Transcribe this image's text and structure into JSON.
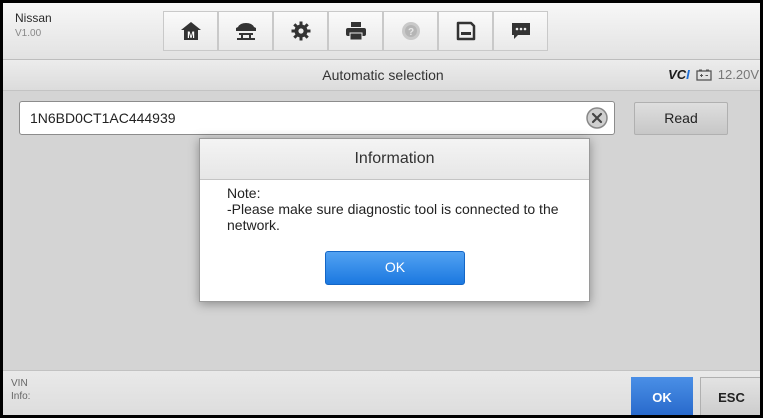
{
  "app": {
    "brand": "Nissan",
    "version": "V1.00"
  },
  "toolbar": {
    "icons": [
      "home-icon",
      "vehicle-lift-icon",
      "gear-icon",
      "printer-icon",
      "help-icon",
      "save-icon",
      "message-icon"
    ],
    "help_disabled": true
  },
  "header": {
    "title": "Automatic selection",
    "connection_label": "VCI",
    "voltage": "12.20V"
  },
  "vin_row": {
    "value": "1N6BD0CT1AC444939",
    "read_label": "Read"
  },
  "dialog": {
    "title": "Information",
    "lines": [
      "Note:",
      "-Please make sure diagnostic tool is connected to the network."
    ],
    "ok_label": "OK"
  },
  "bottom": {
    "info_line1": "VIN",
    "info_line2": "Info:",
    "ok_label": "OK",
    "esc_label": "ESC"
  },
  "colors": {
    "accent": "#1b78e0",
    "brand_vcb": "#1f6fd6",
    "background": "#d4d4d4"
  }
}
